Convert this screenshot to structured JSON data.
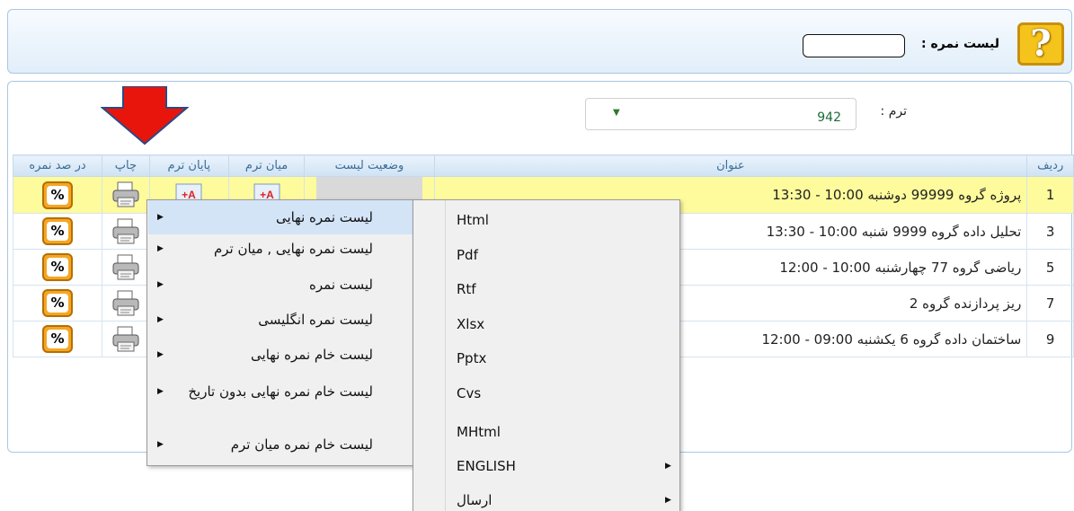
{
  "header": {
    "title": "لیست نمره :",
    "input_value": ""
  },
  "filter": {
    "term_label": "ترم :",
    "term_value": "942"
  },
  "table": {
    "columns": {
      "index": "رديف",
      "title": "عنوان",
      "status": "وضعیت لیست",
      "midterm": "میان ترم",
      "final": "پایان ترم",
      "print": "چاپ",
      "percent": "در صد نمره"
    },
    "rows": [
      {
        "index": "1",
        "title": "پروژه گروه 99999 دوشنبه 10:00 - 13:30",
        "selected": true
      },
      {
        "index": "3",
        "title": "تحلیل داده گروه 9999 شنبه 10:00 - 13:30",
        "selected": false
      },
      {
        "index": "5",
        "title": "رياضی گروه 77 چهارشنبه 10:00 - 12:00",
        "selected": false
      },
      {
        "index": "7",
        "title": "ریز پردازنده گروه 2",
        "selected": false
      },
      {
        "index": "9",
        "title": "ساختمان داده گروه 6 یکشنبه 09:00 - 12:00",
        "selected": false
      }
    ],
    "percent_symbol": "%"
  },
  "context_menu": {
    "items": [
      "لیست نمره نهایی",
      "لیست نمره نهایی , میان ترم",
      "لیست نمره",
      "لیست نمره انگلیسی",
      "لیست خام نمره نهایی",
      "لیست خام نمره نهایی بدون تاریخ",
      "لیست خام نمره میان ترم"
    ],
    "submenu": [
      "Html",
      "Pdf",
      "Rtf",
      "Xlsx",
      "Pptx",
      "Cvs",
      "MHtml",
      "ENGLISH",
      "ارسال"
    ]
  },
  "colors": {
    "selected_row": "#fefb9c",
    "header_text": "#3a6d97",
    "percent_button": "#f5a623",
    "arrow": "#e8150c"
  },
  "icons": [
    "help-icon",
    "printer-icon",
    "grade-a-plus-icon",
    "percent-icon",
    "red-arrow-icon",
    "chevron-down-icon"
  ]
}
